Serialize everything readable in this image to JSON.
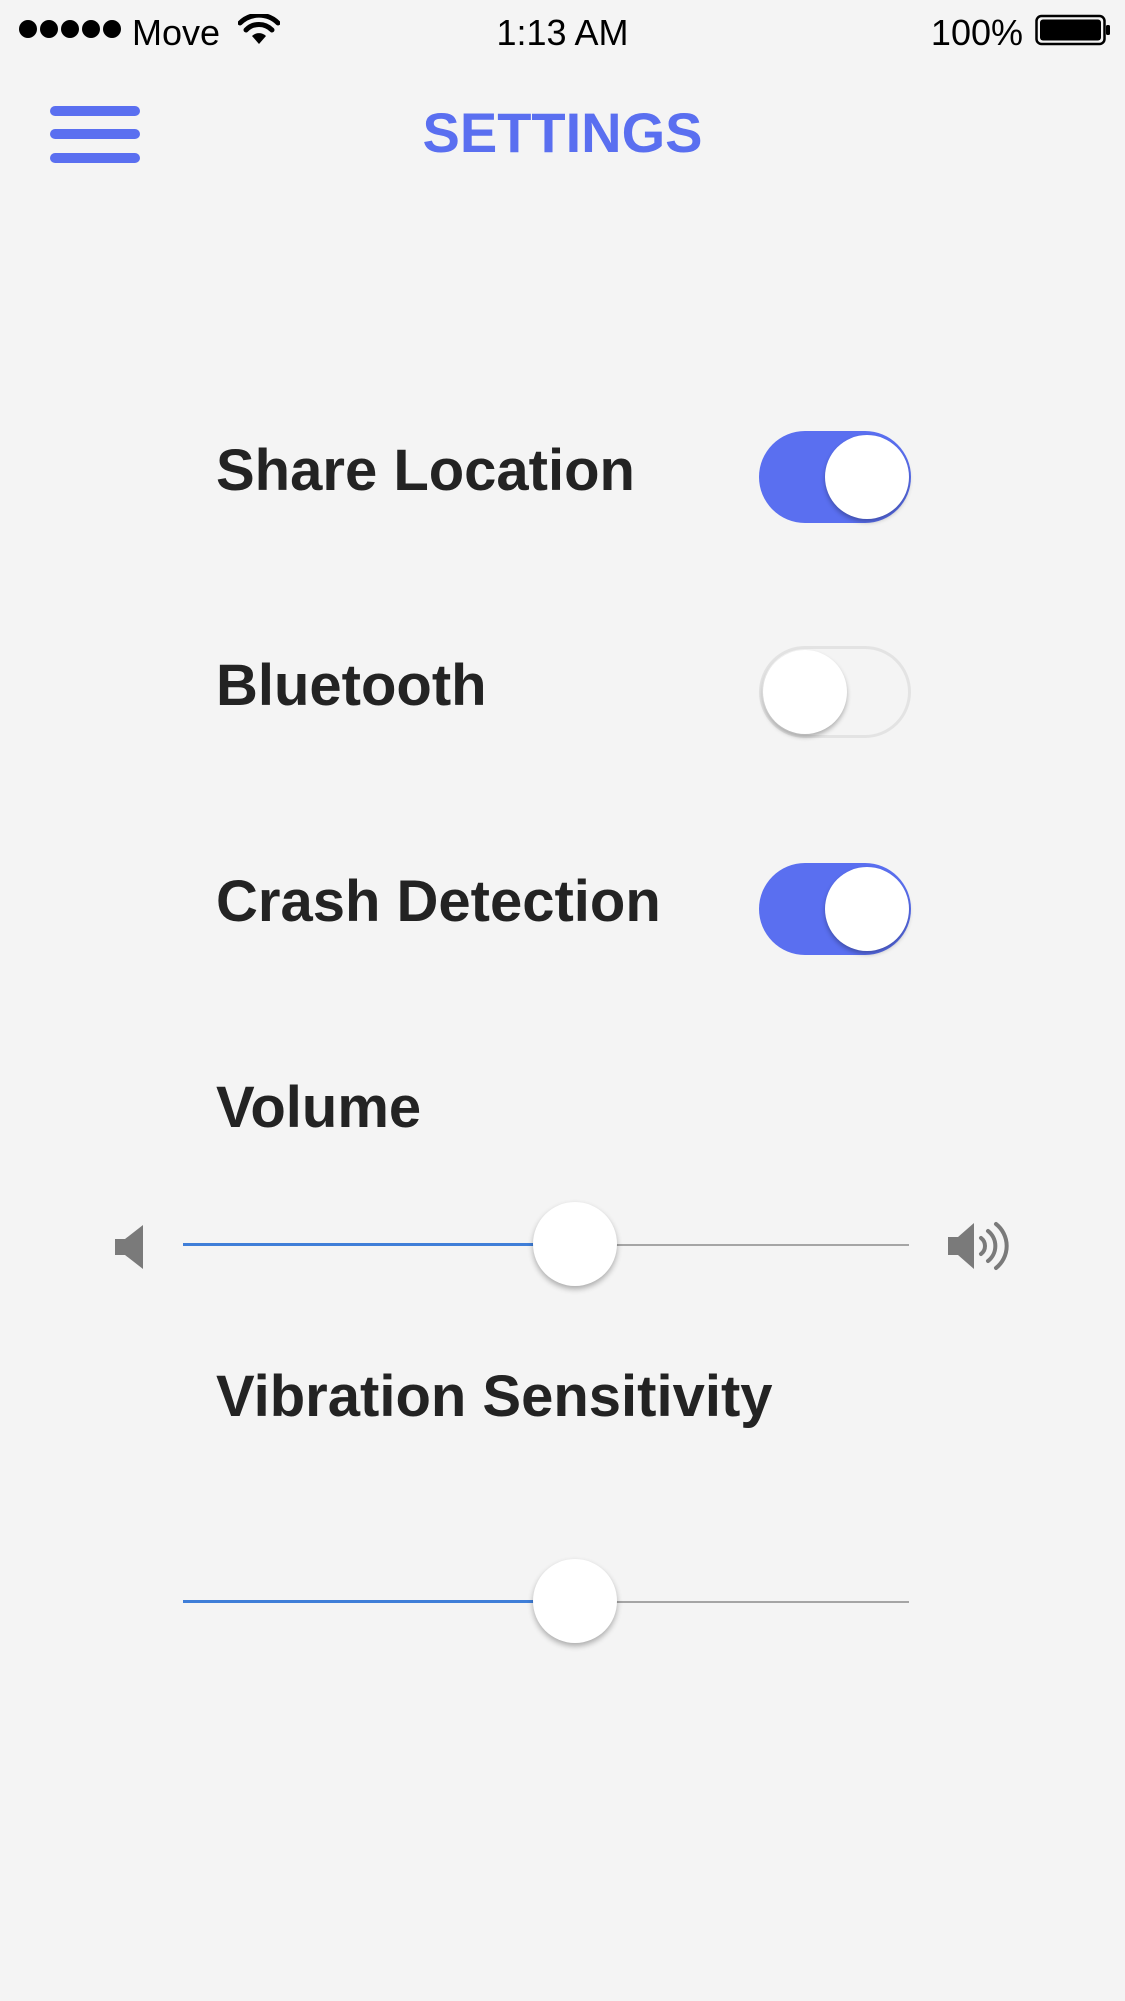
{
  "status_bar": {
    "carrier": "Move",
    "time": "1:13 AM",
    "battery": "100%",
    "signal_icon": "signal-dots-icon",
    "wifi_icon": "wifi-icon",
    "battery_icon": "battery-icon"
  },
  "header": {
    "title": "SETTINGS",
    "menu_icon": "hamburger-menu-icon"
  },
  "settings": {
    "share_location": {
      "label": "Share Location",
      "enabled": true
    },
    "bluetooth": {
      "label": "Bluetooth",
      "enabled": false
    },
    "crash_detection": {
      "label": "Crash Detection",
      "enabled": true
    },
    "volume": {
      "label": "Volume",
      "value": 0.54
    },
    "vibration_sensitivity": {
      "label": "Vibration Sensitivity",
      "value": 0.54
    }
  },
  "colors": {
    "accent": "#5a6ff0",
    "slider_fill": "#3f7ed8",
    "background": "#f4f4f4",
    "text": "#232323"
  }
}
